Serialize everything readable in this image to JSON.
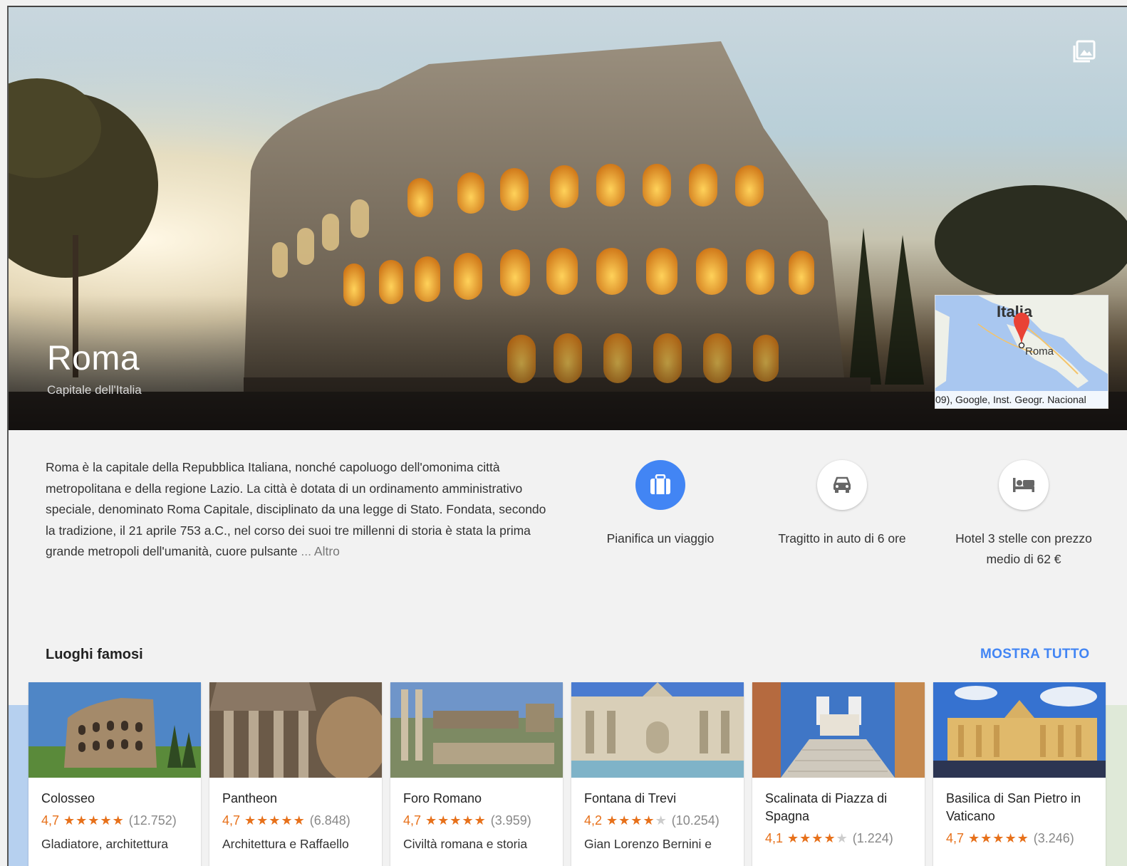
{
  "hero": {
    "title": "Roma",
    "subtitle": "Capitale dell'Italia",
    "gallery_icon": "photo-gallery-icon"
  },
  "map": {
    "country": "Italia",
    "city": "Roma",
    "attribution": "09), Google, Inst. Geogr. Nacional"
  },
  "description": {
    "text": "Roma è la capitale della Repubblica Italiana, nonché capoluogo dell'omonima città metropolitana e della regione Lazio. La città è dotata di un ordinamento amministrativo speciale, denominato Roma Capitale, disciplinato da una legge di Stato. Fondata, secondo la tradizione, il 21 aprile 753 a.C., nel corso dei suoi tre millenni di storia è stata la prima grande metropoli dell'umanità, cuore pulsante",
    "ellipsis": " ... ",
    "more": "Altro"
  },
  "actions": [
    {
      "label": "Pianifica un viaggio",
      "icon": "suitcase-icon"
    },
    {
      "label": "Tragitto in auto di 6 ore",
      "icon": "car-icon"
    },
    {
      "label": "Hotel 3 stelle con prezzo medio di 62 €",
      "icon": "hotel-bed-icon"
    }
  ],
  "section": {
    "title": "Luoghi famosi",
    "show_all": "MOSTRA TUTTO"
  },
  "places": [
    {
      "name": "Colosseo",
      "score": "4,7",
      "stars": 4.7,
      "reviews": "(12.752)",
      "note": "Gladiatore, architettura"
    },
    {
      "name": "Pantheon",
      "score": "4,7",
      "stars": 4.7,
      "reviews": "(6.848)",
      "note": "Architettura e Raffaello"
    },
    {
      "name": "Foro Romano",
      "score": "4,7",
      "stars": 4.7,
      "reviews": "(3.959)",
      "note": "Civiltà romana e storia"
    },
    {
      "name": "Fontana di Trevi",
      "score": "4,2",
      "stars": 4.2,
      "reviews": "(10.254)",
      "note": "Gian Lorenzo Bernini e"
    },
    {
      "name": "Scalinata di Piazza di Spagna",
      "score": "4,1",
      "stars": 4.1,
      "reviews": "(1.224)",
      "note": ""
    },
    {
      "name": "Basilica di San Pietro in Vaticano",
      "score": "4,7",
      "stars": 4.7,
      "reviews": "(3.246)",
      "note": ""
    }
  ],
  "colors": {
    "accent": "#4285f4",
    "rating": "#e7711b",
    "map_pin": "#e94235"
  }
}
